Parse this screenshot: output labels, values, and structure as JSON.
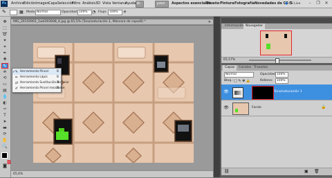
{
  "app": {
    "logo": "Ps"
  },
  "menubar": {
    "items": [
      "Archivo",
      "Edición",
      "Imagen",
      "Capa",
      "Selección",
      "Filtro",
      "Análisis",
      "3D",
      "Vista",
      "Ventana",
      "Ayuda"
    ],
    "workspace_button": "Br",
    "workspace_active": "pdsd",
    "workspaces": [
      "Aspectos esenciales",
      "Diseño",
      "Pintura",
      "Fotografía",
      "Novedades de CS 5"
    ],
    "cs_live": "CS Live"
  },
  "options": {
    "mode_label": "Modo:",
    "mode_value": "Normal",
    "opacity_label": "Opacidad:",
    "opacity_value": "100%",
    "flow_label": "Flujo:",
    "flow_value": "100%"
  },
  "document": {
    "tab_title": "IMG_20150901_1w4393698_4.jpg @ 65,5% (Tono/saturación 1, Máscara de capa/8) *",
    "status": "65,6%"
  },
  "flyout": {
    "items": [
      {
        "label": "Herramienta Pincel",
        "key": "B",
        "icon": "brush-icon",
        "selected": true
      },
      {
        "label": "Herramienta Lápiz",
        "key": "B",
        "icon": "pencil-icon",
        "selected": false
      },
      {
        "label": "Herramienta Sustitución de color",
        "key": "B",
        "icon": "color-replace-icon",
        "selected": false
      },
      {
        "label": "Herramienta Pincel mezclador",
        "key": "B",
        "icon": "mixer-brush-icon",
        "selected": false
      }
    ]
  },
  "annotation": {
    "tool_marker": "B"
  },
  "navigator": {
    "tabs": [
      "Información",
      "Navegador"
    ],
    "active_tab": "Navegador",
    "zoom": "65,57%"
  },
  "layers": {
    "tabs": [
      "Capas",
      "Canales",
      "Trazados"
    ],
    "blend_mode": "Normal",
    "opacity_label": "Opacidad:",
    "opacity_value": "100%",
    "lock_label": "Bloq.:",
    "fill_label": "Relleno:",
    "fill_value": "100%",
    "items": [
      {
        "name": "Tono/saturación 1",
        "selected": true
      },
      {
        "name": "Fondo",
        "selected": false
      }
    ]
  },
  "colors": {
    "selection_blue": "#3d8fe0",
    "highlight_red": "#e0222e",
    "facade": "#e7c7ad",
    "window_green": "#57e02a"
  }
}
